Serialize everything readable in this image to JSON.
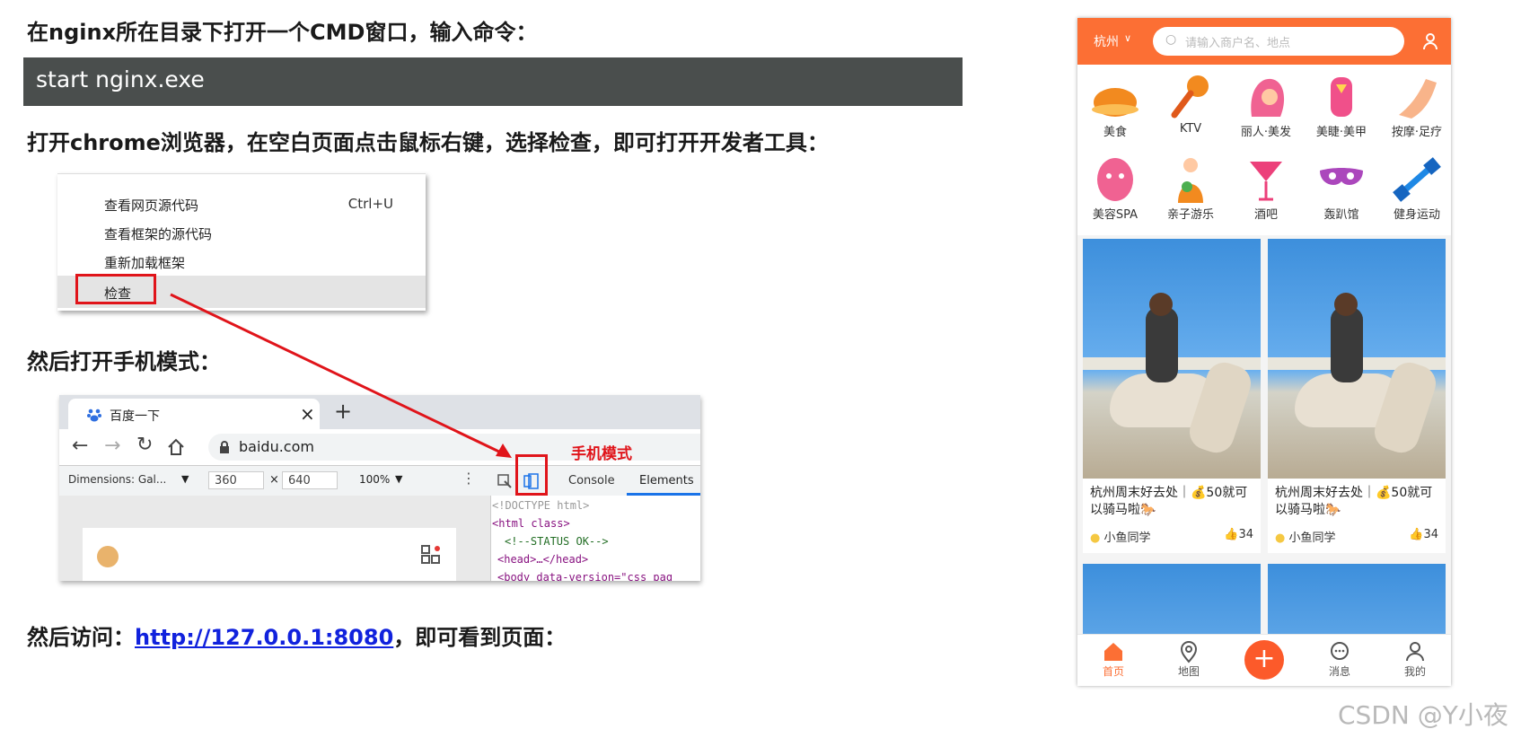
{
  "instructions": {
    "step1": "在nginx所在目录下打开一个CMD窗口，输入命令：",
    "command": "start nginx.exe",
    "step2": "打开chrome浏览器，在空白页面点击鼠标右键，选择检查，即可打开开发者工具：",
    "step3": "然后打开手机模式：",
    "step4_prefix": "然后访问：",
    "step4_link": "http://127.0.0.1:8080",
    "step4_suffix": "，即可看到页面："
  },
  "context_menu": {
    "items": [
      {
        "label": "查看网页源代码",
        "shortcut": "Ctrl+U"
      },
      {
        "label": "查看框架的源代码",
        "shortcut": ""
      },
      {
        "label": "重新加载框架",
        "shortcut": ""
      },
      {
        "label": "检查",
        "shortcut": ""
      }
    ]
  },
  "browser": {
    "tab_title": "百度一下",
    "tab_close": "×",
    "new_tab": "+",
    "url": "baidu.com",
    "dimensions": "Dimensions: Gal...",
    "width": "360",
    "times": "×",
    "height": "640",
    "zoom": "100%",
    "devtools_tabs": [
      "Console",
      "Elements"
    ],
    "mobile_mode_label": "手机模式",
    "code_lines": [
      "<!DOCTYPE html>",
      "<html class>",
      "<!--STATUS OK-->",
      "<head>…</head>",
      "<body data-version=\"css_pag"
    ]
  },
  "phone": {
    "city": "杭州",
    "search_placeholder": "请输入商户名、地点",
    "categories": [
      "美食",
      "KTV",
      "丽人·美发",
      "美睫·美甲",
      "按摩·足疗",
      "美容SPA",
      "亲子游乐",
      "酒吧",
      "轰趴馆",
      "健身运动"
    ],
    "cards": [
      {
        "title": "杭州周末好去处｜💰50就可以骑马啦🐎",
        "author": "小鱼同学",
        "likes": "34"
      },
      {
        "title": "杭州周末好去处｜💰50就可以骑马啦🐎",
        "author": "小鱼同学",
        "likes": "34"
      }
    ],
    "nav": [
      "首页",
      "地图",
      "消息",
      "我的"
    ],
    "accent": "#fc6f34"
  },
  "watermark": "CSDN @Y小夜"
}
